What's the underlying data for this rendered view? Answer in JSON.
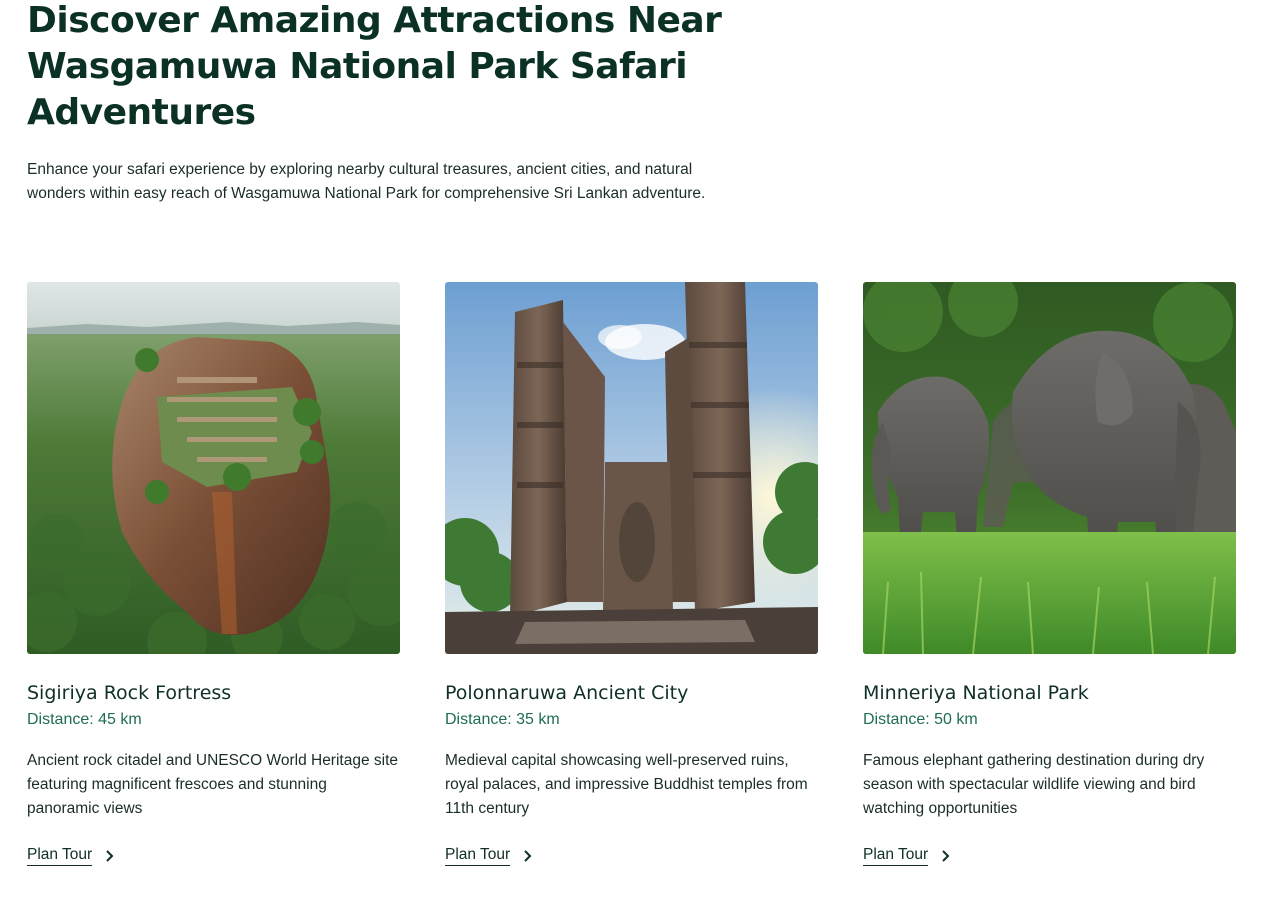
{
  "hero": {
    "title": "Discover Amazing Attractions Near Wasgamuwa National Park Safari Adventures",
    "subtitle": "Enhance your safari experience by exploring nearby cultural treasures,  ancient cities, and natural wonders within easy reach of Wasgamuwa  National Park for comprehensive Sri Lankan adventure."
  },
  "cards": [
    {
      "title": "Sigiriya Rock Fortress",
      "distance": "Distance: 45 km",
      "description": "Ancient rock citadel and UNESCO World Heritage site featuring magnificent frescoes and stunning panoramic views",
      "cta": "Plan Tour",
      "image": "sigiriya-rock-aerial-photo"
    },
    {
      "title": "Polonnaruwa Ancient City",
      "distance": "Distance: 35 km",
      "description": "Medieval capital showcasing well-preserved ruins, royal palaces, and impressive Buddhist temples from 11th century",
      "cta": "Plan Tour",
      "image": "polonnaruwa-ruins-photo"
    },
    {
      "title": "Minneriya National Park",
      "distance": "Distance: 50 km",
      "description": "Famous elephant gathering destination during dry season with spectacular wildlife viewing and bird watching opportunities",
      "cta": "Plan Tour",
      "image": "elephants-photo"
    }
  ],
  "colors": {
    "heading": "#0b3026",
    "accent": "#1f6d52",
    "body_text": "#1b2d28"
  },
  "icons": {
    "cta": "chevron-right-icon"
  }
}
